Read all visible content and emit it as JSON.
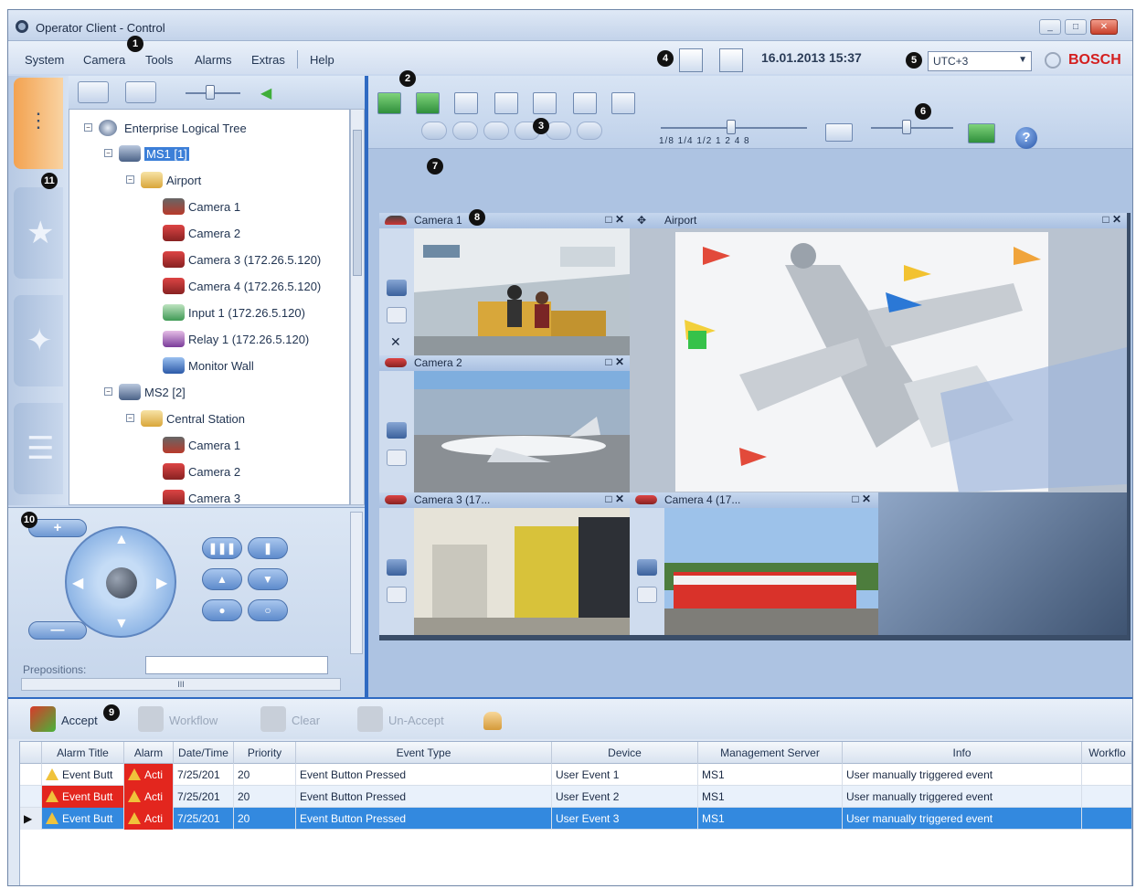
{
  "window": {
    "title": "Operator Client - Control",
    "controls": [
      "_",
      "□",
      "✕"
    ]
  },
  "menu": [
    "System",
    "Camera",
    "Tools",
    "Alarms",
    "Extras",
    "Help"
  ],
  "callouts": [
    "1",
    "2",
    "3",
    "4",
    "5",
    "6",
    "7",
    "8",
    "9",
    "10",
    "11"
  ],
  "status": {
    "datetime": "16.01.2013 15:37",
    "timezone": "UTC+3",
    "brand": "BOSCH"
  },
  "tree": {
    "root": "Enterprise Logical Tree",
    "items": [
      {
        "label": "MS1 [1]",
        "icon": "server-icon",
        "level": 1
      },
      {
        "label": "Airport",
        "icon": "folder-icon",
        "level": 2
      },
      {
        "label": "Camera 1",
        "icon": "dome-camera-icon",
        "level": 3
      },
      {
        "label": "Camera 2",
        "icon": "box-camera-icon",
        "level": 3
      },
      {
        "label": "Camera 3 (172.26.5.120)",
        "icon": "box-camera-icon",
        "level": 3
      },
      {
        "label": "Camera 4 (172.26.5.120)",
        "icon": "box-camera-icon",
        "level": 3
      },
      {
        "label": "Input 1 (172.26.5.120)",
        "icon": "input-icon",
        "level": 3
      },
      {
        "label": "Relay 1 (172.26.5.120)",
        "icon": "relay-icon",
        "level": 3
      },
      {
        "label": "Monitor Wall",
        "icon": "monitor-wall-icon",
        "level": 3
      },
      {
        "label": "MS2 [2]",
        "icon": "server-icon",
        "level": 1
      },
      {
        "label": "Central Station",
        "icon": "folder-icon",
        "level": 2
      },
      {
        "label": "Camera 1",
        "icon": "dome-camera-icon",
        "level": 3
      },
      {
        "label": "Camera 2",
        "icon": "box-camera-icon",
        "level": 3
      },
      {
        "label": "Camera 3",
        "icon": "box-camera-icon",
        "level": 3
      }
    ]
  },
  "playback": {
    "speeds": "1/8 1/4 1/2  1   2   4   8"
  },
  "ptz": {
    "zoom_in": "+",
    "zoom_out": "—",
    "prepositions_label": "Prepositions:",
    "scroll_text": "III"
  },
  "cells": {
    "camera1": "Camera 1",
    "airport": "Airport",
    "camera2": "Camera 2",
    "camera3": "Camera 3 (17...",
    "camera4": "Camera 4 (17..."
  },
  "alarm_toolbar": {
    "accept": "Accept",
    "workflow": "Workflow",
    "clear": "Clear",
    "unaccept": "Un-Accept"
  },
  "alarm_grid": {
    "columns": [
      "Alarm Title",
      "Alarm",
      "Date/Time",
      "Priority",
      "Event Type",
      "Device",
      "Management Server",
      "Info",
      "Workflo"
    ],
    "rows": [
      [
        "Event Butt",
        "Acti",
        "7/25/201",
        "20",
        "Event Button Pressed",
        "User Event 1",
        "MS1",
        "User manually triggered event"
      ],
      [
        "Event Butt",
        "Acti",
        "7/25/201",
        "20",
        "Event Button Pressed",
        "User Event 2",
        "MS1",
        "User manually triggered event"
      ],
      [
        "Event Butt",
        "Acti",
        "7/25/201",
        "20",
        "Event Button Pressed",
        "User Event 3",
        "MS1",
        "User manually triggered event"
      ]
    ]
  }
}
